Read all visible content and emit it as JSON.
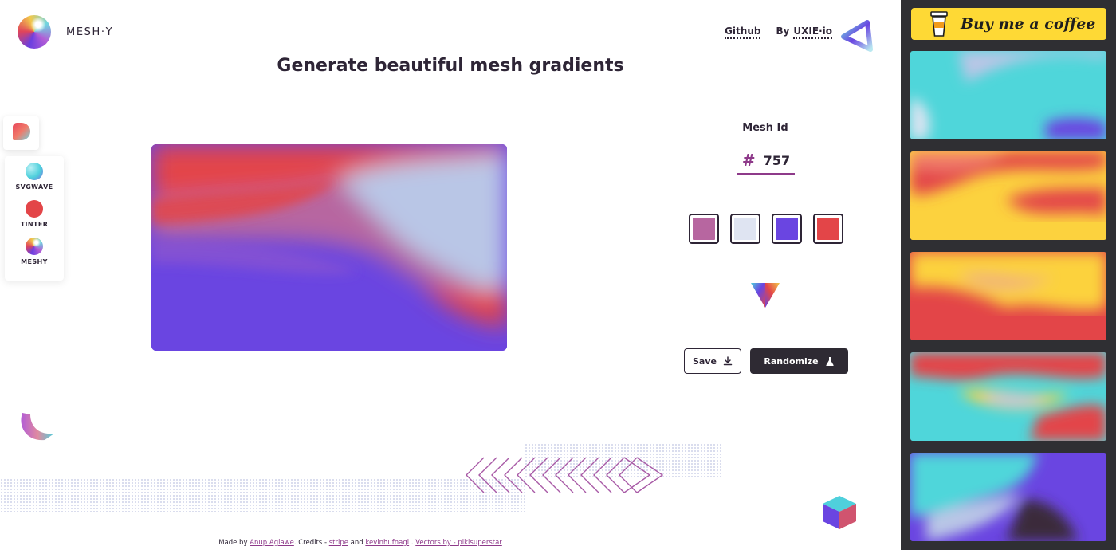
{
  "app": {
    "name": "MESH·Y"
  },
  "nav": {
    "github": "Github",
    "by_prefix": "By",
    "uxie": "UXIE·io"
  },
  "headline": "Generate beautiful mesh gradients",
  "sidebar": {
    "items": [
      {
        "label": "SVGWAVE",
        "icon": "svgwave-icon"
      },
      {
        "label": "TINTER",
        "icon": "tinter-icon"
      },
      {
        "label": "MESHY",
        "icon": "meshy-icon"
      }
    ]
  },
  "mesh": {
    "title": "Mesh Id",
    "hash": "#",
    "id": "757"
  },
  "palette": {
    "colors": [
      "#b766a0",
      "#dfe4f2",
      "#6a45e1",
      "#e34548"
    ]
  },
  "buttons": {
    "save": "Save",
    "randomize": "Randomize"
  },
  "footer": {
    "made_by": "Made by",
    "author": "Anup Aglawe",
    "credits": ". Credits -",
    "stripe": "stripe",
    "and": "and",
    "kevin": "kevinhufnagl",
    "sep": ".",
    "vectors": "Vectors by - pikisuperstar"
  },
  "rightbar": {
    "coffee": "Buy me a coffee",
    "thumbnails": 5
  }
}
